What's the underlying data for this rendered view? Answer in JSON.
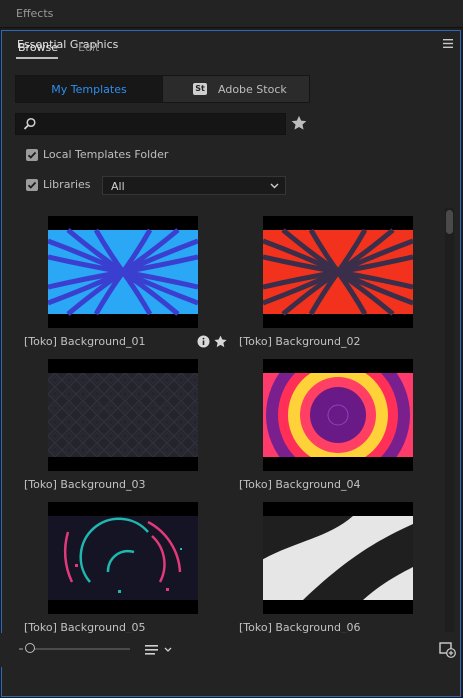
{
  "effects_panel": {
    "title": "Effects"
  },
  "panel": {
    "title": "Essential Graphics",
    "menu_icon": "hamburger-menu-icon",
    "accent_color": "#2d69b8"
  },
  "tabs": [
    {
      "label": "Browse",
      "active": true
    },
    {
      "label": "Edit",
      "active": false
    }
  ],
  "source_toggle": {
    "my_templates": "My Templates",
    "adobe_stock_badge": "St",
    "adobe_stock": "Adobe Stock",
    "active": "My Templates",
    "active_color": "#2f8ef0"
  },
  "search": {
    "placeholder": "",
    "value": ""
  },
  "filters": {
    "local_templates_label": "Local Templates Folder",
    "local_templates_checked": true,
    "libraries_label": "Libraries",
    "libraries_checked": true,
    "libraries_selected": "All"
  },
  "templates": [
    {
      "name": "[Toko] Background_01",
      "thumb": "blue-stripes-pattern"
    },
    {
      "name": "[Toko] Background_02",
      "thumb": "red-stripes-pattern"
    },
    {
      "name": "[Toko] Background_03",
      "thumb": "dark-geometric-pattern"
    },
    {
      "name": "[Toko] Background_04",
      "thumb": "concentric-rings"
    },
    {
      "name": "[Toko] Background_05",
      "thumb": "neon-arcs"
    },
    {
      "name": "[Toko] Background_06",
      "thumb": "white-diagonal-waves"
    }
  ],
  "icons": {
    "search": "search-icon",
    "favorite_filter": "star-icon",
    "info": "info-icon",
    "favorite": "star-icon",
    "sort": "sort-list-icon",
    "new_item": "new-item-icon"
  }
}
